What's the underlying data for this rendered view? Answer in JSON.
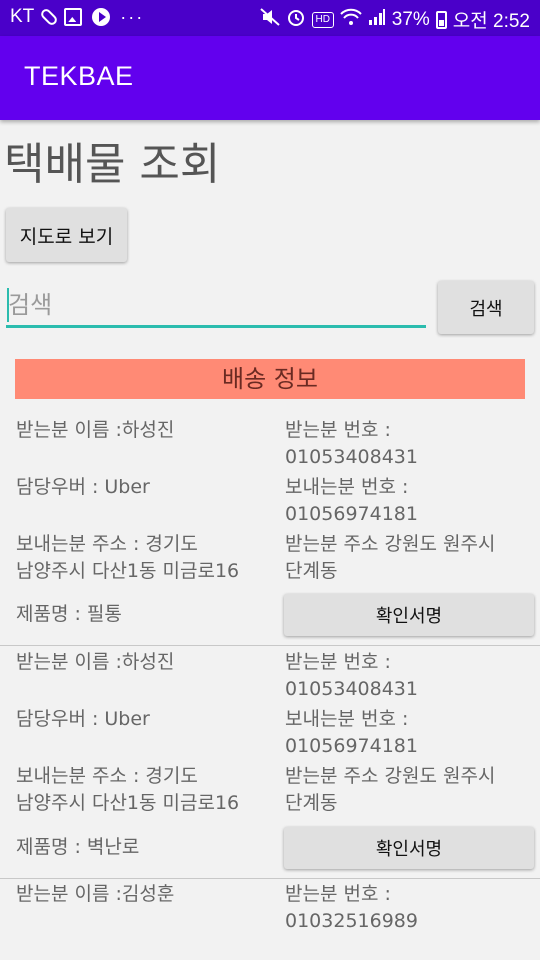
{
  "status_bar": {
    "carrier": "KT",
    "overflow": "···",
    "battery": "37%",
    "time": "오전 2:52",
    "hd": "HD",
    "left_icons": [
      "paperclip-icon",
      "image-icon",
      "play-icon"
    ],
    "right_icons": [
      "mute-icon",
      "alarm-icon",
      "hd-icon",
      "wifi-icon",
      "signal-icon",
      "battery-icon"
    ]
  },
  "app_bar": {
    "title": "TEKBAE",
    "color": "#6200ee"
  },
  "page": {
    "title": "택배물 조회",
    "map_button": "지도로 보기",
    "search_placeholder": "검색",
    "search_button": "검색",
    "section_header": "배송 정보",
    "accent": "#2bbcae",
    "header_color": "#ff8a75"
  },
  "records": [
    {
      "receiver_name": "받는분 이름 :하성진",
      "receiver_phone": "받는분 번호 :\n01053408431",
      "driver": "담당우버 : Uber",
      "sender_phone": "보내는분 번호 :\n01056974181",
      "sender_address": "보내는분 주소 : 경기도\n남양주시 다산1동 미금로16",
      "receiver_address": "받는분 주소 강원도 원주시\n단계동",
      "product": "제품명 : 필통",
      "confirm_button": "확인서명"
    },
    {
      "receiver_name": "받는분 이름 :하성진",
      "receiver_phone": "받는분 번호 :\n01053408431",
      "driver": "담당우버 : Uber",
      "sender_phone": "보내는분 번호 :\n01056974181",
      "sender_address": "보내는분 주소 : 경기도\n남양주시 다산1동 미금로16",
      "receiver_address": "받는분 주소 강원도 원주시\n단계동",
      "product": "제품명 : 벽난로",
      "confirm_button": "확인서명"
    },
    {
      "receiver_name": "받는분 이름 :김성훈",
      "receiver_phone": "받는분 번호 :\n01032516989"
    }
  ]
}
